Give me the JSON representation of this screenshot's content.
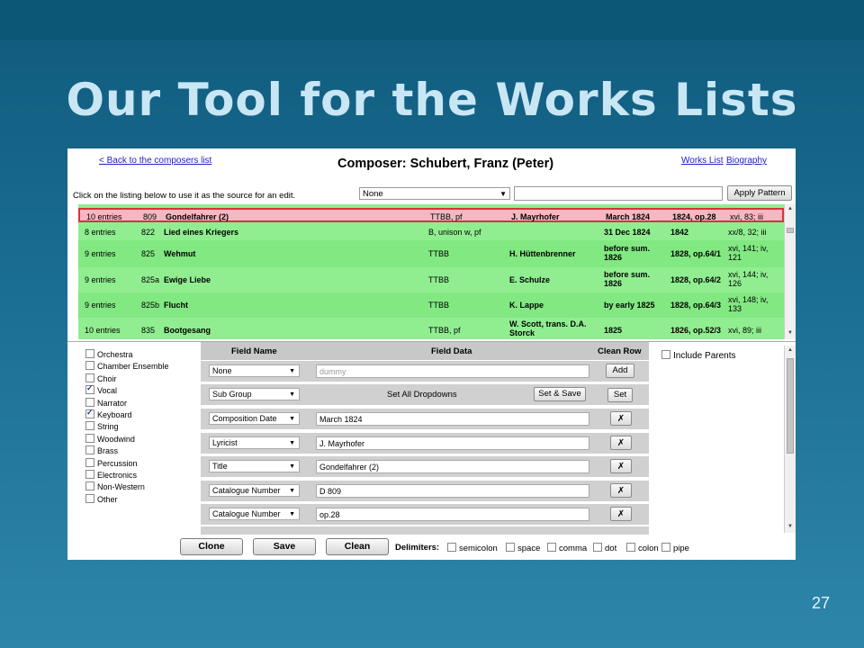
{
  "slide": {
    "title": "Our Tool for the Works Lists",
    "number": "27"
  },
  "header": {
    "back_link": "< Back to the composers list",
    "composer": "Composer: Schubert, Franz (Peter)",
    "works_link": "Works List",
    "bio_link": "Biography",
    "hint": "Click on the listing below to use it as the source for an edit.",
    "pattern_selected": "None",
    "pattern_value": "",
    "apply_label": "Apply Pattern"
  },
  "listing": [
    {
      "entries": "10 entries",
      "num": "809",
      "title": "Gondelfahrer (2)",
      "scoring": "TTBB, pf",
      "lyricist": "J. Mayrhofer",
      "date": "March 1824",
      "pub": "1824, op.28",
      "ref": "xvi, 83; iii",
      "selected": true
    },
    {
      "entries": "8 entries",
      "num": "822",
      "title": "Lied eines Kriegers",
      "scoring": "B, unison w, pf",
      "lyricist": "",
      "date": "31 Dec 1824",
      "pub": "1842",
      "ref": "xx/8, 32; iii",
      "selected": false
    },
    {
      "entries": "9 entries",
      "num": "825",
      "title": "Wehmut",
      "scoring": "TTBB",
      "lyricist": "H. Hüttenbrenner",
      "date": "before sum. 1826",
      "pub": "1828, op.64/1",
      "ref": "xvi, 141; iv, 121",
      "selected": false
    },
    {
      "entries": "9 entries",
      "num": "825a",
      "title": "Ewige Liebe",
      "scoring": "TTBB",
      "lyricist": "E. Schulze",
      "date": "before sum. 1826",
      "pub": "1828, op.64/2",
      "ref": "xvi, 144; iv, 126",
      "selected": false
    },
    {
      "entries": "9 entries",
      "num": "825b",
      "title": "Flucht",
      "scoring": "TTBB",
      "lyricist": "K. Lappe",
      "date": "by early 1825",
      "pub": "1828, op.64/3",
      "ref": "xvi, 148; iv, 133",
      "selected": false
    },
    {
      "entries": "10 entries",
      "num": "835",
      "title": "Bootgesang",
      "scoring": "TTBB, pf",
      "lyricist": "W. Scott, trans. D.A. Storck",
      "date": "1825",
      "pub": "1826, op.52/3",
      "ref": "xvi, 89; iii",
      "selected": false
    }
  ],
  "categories": [
    {
      "label": "Orchestra",
      "checked": false
    },
    {
      "label": "Chamber Ensemble",
      "checked": false
    },
    {
      "label": "Choir",
      "checked": false
    },
    {
      "label": "Vocal",
      "checked": true
    },
    {
      "label": "Narrator",
      "checked": false
    },
    {
      "label": "Keyboard",
      "checked": true
    },
    {
      "label": "String",
      "checked": false
    },
    {
      "label": "Woodwind",
      "checked": false
    },
    {
      "label": "Brass",
      "checked": false
    },
    {
      "label": "Percussion",
      "checked": false
    },
    {
      "label": "Electronics",
      "checked": false
    },
    {
      "label": "Non-Western",
      "checked": false
    },
    {
      "label": "Other",
      "checked": false
    }
  ],
  "fields": {
    "head_name": "Field Name",
    "head_data": "Field Data",
    "head_clean": "Clean Row",
    "add_row": {
      "select": "None",
      "placeholder": "dummy",
      "button": "Add"
    },
    "subgroup_row": {
      "select": "Sub Group",
      "label": "Set All Dropdowns",
      "set_save": "Set & Save",
      "set": "Set"
    },
    "rows": [
      {
        "name": "Composition Date",
        "value": "March 1824",
        "clean": "✗"
      },
      {
        "name": "Lyricist",
        "value": "J. Mayrhofer",
        "clean": "✗"
      },
      {
        "name": "Title",
        "value": "Gondelfahrer (2)",
        "clean": "✗"
      },
      {
        "name": "Catalogue Number",
        "value": "D 809",
        "clean": "✗"
      },
      {
        "name": "Catalogue Number",
        "value": "op.28",
        "clean": "✗"
      }
    ],
    "include_parents": "Include Parents"
  },
  "bottom": {
    "clone": "Clone",
    "save": "Save",
    "clean": "Clean",
    "delimiters_label": "Delimiters:",
    "delimiters": [
      "semicolon",
      "space",
      "comma",
      "dot",
      "colon",
      "pipe"
    ]
  },
  "colors": {
    "row_green": "#90ee90",
    "row_selected": "#f4b8c2",
    "selected_border": "#d8323c",
    "link": "#2020c8"
  }
}
